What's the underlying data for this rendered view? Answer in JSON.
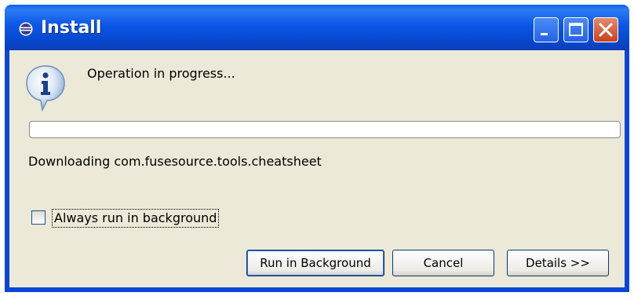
{
  "window": {
    "title": "Install"
  },
  "dialog": {
    "message": "Operation in progress...",
    "status": "Downloading com.fusesource.tools.cheatsheet",
    "progress": {
      "segments": 3,
      "color": "#35c535"
    },
    "checkbox": {
      "label": "Always run in background",
      "checked": false
    },
    "buttons": {
      "run_background": "Run in Background",
      "cancel": "Cancel",
      "details": "Details >>"
    }
  },
  "colors": {
    "titlebar": "#0b56e6",
    "client": "#ece9d8",
    "close_button": "#c8421f"
  },
  "icons": {
    "app": "eclipse-icon",
    "message": "info-icon"
  }
}
